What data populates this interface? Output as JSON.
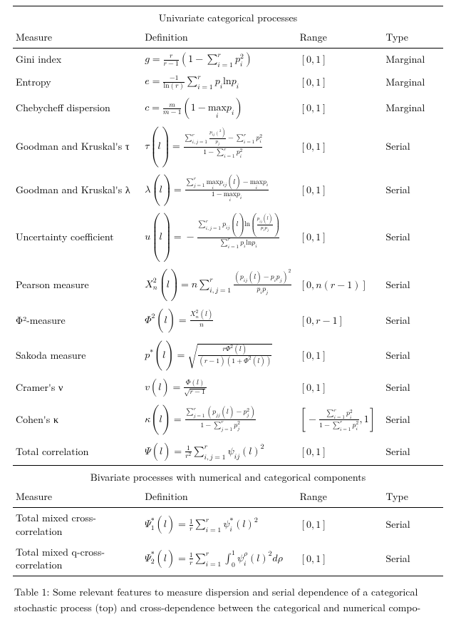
{
  "section1": "Univariate categorical processes",
  "section2": "Bivariate processes with numerical and categorical components",
  "headers": {
    "measure": "Measure",
    "definition": "Definition",
    "range": "Range",
    "type": "Type"
  },
  "types": {
    "marg": "Marginal",
    "ser": "Serial"
  },
  "rows1": {
    "r1": {
      "m": "Gini index"
    },
    "r2": {
      "m": "Entropy"
    },
    "r3": {
      "m": "Chebycheff dispersion"
    },
    "r4": {
      "m": "Goodman and Kruskal's τ"
    },
    "r5": {
      "m": "Goodman and Kruskal's λ"
    },
    "r6": {
      "m": "Uncertainty coefficient"
    },
    "r7": {
      "m": "Pearson measure"
    },
    "r8": {
      "m": "Φ²-measure"
    },
    "r9": {
      "m": "Sakoda measure"
    },
    "r10": {
      "m": "Cramer's ν"
    },
    "r11": {
      "m": "Cohen's κ"
    },
    "r12": {
      "m": "Total correlation"
    }
  },
  "rows2": {
    "r1": {
      "m": "Total mixed cross-correlation"
    },
    "r2": {
      "m": "Total mixed q-cross-correlation"
    }
  },
  "caption": "Table 1: Some relevant features to measure dispersion and serial dependence of a categorical stochastic process (top) and cross-dependence between the categorical and numerical compo-",
  "chart_data": {
    "type": "table",
    "title": "Table 1: dispersion / serial-dependence measures for categorical processes",
    "columns": [
      "Measure",
      "Definition",
      "Range",
      "Type"
    ],
    "univariate": [
      {
        "measure": "Gini index",
        "definition": "g = r/(r-1) * (1 - sum_{i=1}^{r} p_i^2)",
        "range": "[0, 1]",
        "type": "Marginal"
      },
      {
        "measure": "Entropy",
        "definition": "e = -1/ln(r) * sum_{i=1}^{r} p_i ln p_i",
        "range": "[0, 1]",
        "type": "Marginal"
      },
      {
        "measure": "Chebycheff dispersion",
        "definition": "c = m/(m-1) * (1 - max_i p_i)",
        "range": "[0, 1]",
        "type": "Marginal"
      },
      {
        "measure": "Goodman and Kruskal's tau",
        "definition": "tau(l) = ( sum_{i,j=1}^{r} p_{ij}(l)^2 / p_j  -  sum_{i=1}^{r} p_i^2 ) / ( 1 - sum_{i=1}^{r} p_i^2 )",
        "range": "[0, 1]",
        "type": "Serial"
      },
      {
        "measure": "Goodman and Kruskal's lambda",
        "definition": "lambda(l) = ( sum_{j=1}^{r} max_i p_{ij}(l) - max_i p_i ) / ( 1 - max_i p_i )",
        "range": "[0, 1]",
        "type": "Serial"
      },
      {
        "measure": "Uncertainty coefficient",
        "definition": "u(l) = - sum_{i,j=1}^{r} p_{ij}(l) ln( p_{ij}(l) / (p_i p_j) ) / ( sum_{i=1}^{r} p_i ln p_i )",
        "range": "[0, 1]",
        "type": "Serial"
      },
      {
        "measure": "Pearson measure",
        "definition": "Chi_n^2(l) = n * sum_{i,j=1}^{r} ( p_{ij}(l) - p_i p_j )^2 / ( p_i p_j )",
        "range": "[0, n(r-1)]",
        "type": "Serial"
      },
      {
        "measure": "Phi^2-measure",
        "definition": "Phi^2(l) = Chi_n^2(l) / n",
        "range": "[0, r-1]",
        "type": "Serial"
      },
      {
        "measure": "Sakoda measure",
        "definition": "p*(l) = sqrt( r * Phi^2(l) / ( (r-1)(1 + Phi^2(l)) ) )",
        "range": "[0, 1]",
        "type": "Serial"
      },
      {
        "measure": "Cramer's v",
        "definition": "v(l) = Phi(l) / sqrt(r - 1)",
        "range": "[0, 1]",
        "type": "Serial"
      },
      {
        "measure": "Cohen's kappa",
        "definition": "kappa(l) = ( sum_{j=1}^{r} ( p_{jj}(l) - p_j^2 ) ) / ( 1 - sum_{j=1}^{r} p_j^2 )",
        "range": "[ - sum_{i=1}^{r} p_i^2 / (1 - sum_{i=1}^{r} p_i^2), 1 ]",
        "type": "Serial"
      },
      {
        "measure": "Total correlation",
        "definition": "Psi(l) = (1/r^2) * sum_{i,j=1}^{r} psi_{ij}(l)^2",
        "range": "[0, 1]",
        "type": "Serial"
      }
    ],
    "bivariate": [
      {
        "measure": "Total mixed cross-correlation",
        "definition": "Psi_1^*(l) = (1/r) * sum_{i=1}^{r} psi_i^*(l)^2",
        "range": "[0, 1]",
        "type": "Serial"
      },
      {
        "measure": "Total mixed q-cross-correlation",
        "definition": "Psi_2^*(l) = (1/r) * sum_{i=1}^{r} integral_0^1 psi_i^rho(l)^2 d rho",
        "range": "[0, 1]",
        "type": "Serial"
      }
    ]
  }
}
